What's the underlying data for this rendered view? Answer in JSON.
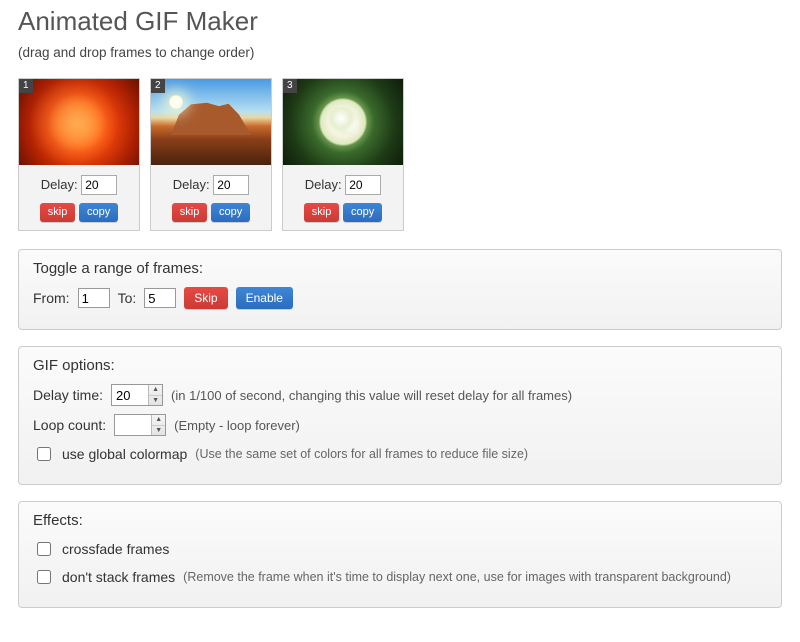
{
  "header": {
    "title": "Animated GIF Maker",
    "subtitle": "(drag and drop frames to change order)"
  },
  "frames": [
    {
      "index": "1",
      "delay_label": "Delay:",
      "delay": "20",
      "skip_label": "skip",
      "copy_label": "copy"
    },
    {
      "index": "2",
      "delay_label": "Delay:",
      "delay": "20",
      "skip_label": "skip",
      "copy_label": "copy"
    },
    {
      "index": "3",
      "delay_label": "Delay:",
      "delay": "20",
      "skip_label": "skip",
      "copy_label": "copy"
    }
  ],
  "toggle_panel": {
    "title": "Toggle a range of frames:",
    "from_label": "From:",
    "from_value": "1",
    "to_label": "To:",
    "to_value": "5",
    "skip_label": "Skip",
    "enable_label": "Enable"
  },
  "options_panel": {
    "title": "GIF options:",
    "delay_label": "Delay time:",
    "delay_value": "20",
    "delay_hint": "(in 1/100 of second, changing this value will reset delay for all frames)",
    "loop_label": "Loop count:",
    "loop_value": "",
    "loop_hint": "(Empty - loop forever)",
    "colormap_label": "use global colormap",
    "colormap_hint": "(Use the same set of colors for all frames to reduce file size)"
  },
  "effects_panel": {
    "title": "Effects:",
    "crossfade_label": "crossfade frames",
    "dontstack_label": "don't stack frames",
    "dontstack_hint": "(Remove the frame when it's time to display next one, use for images with transparent background)"
  }
}
